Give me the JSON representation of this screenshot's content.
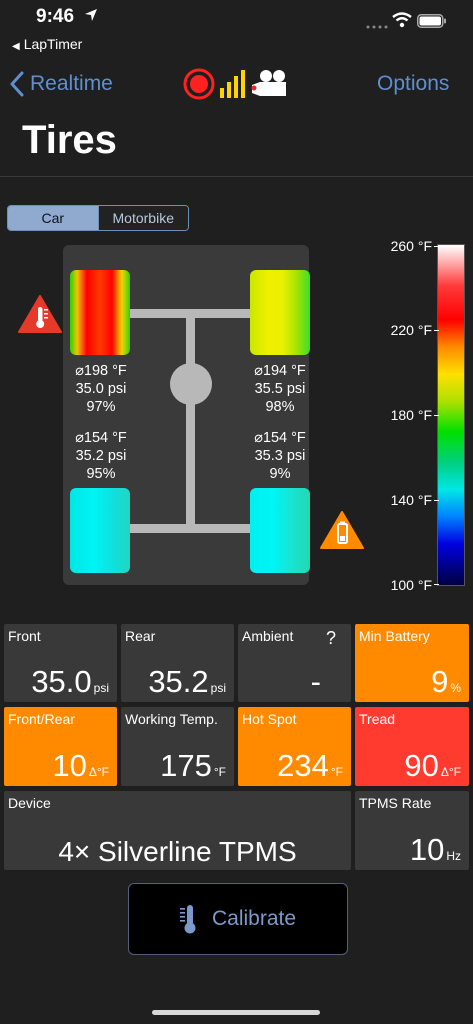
{
  "status": {
    "time": "9:46",
    "back_app": "LapTimer"
  },
  "nav": {
    "back_label": "Realtime",
    "options_label": "Options"
  },
  "title": "Tires",
  "segmented": {
    "options": [
      "Car",
      "Motorbike"
    ],
    "selected": "Car"
  },
  "tires": {
    "front_left": {
      "temp": "⌀198 °F",
      "pressure": "35.0 psi",
      "battery": "97%"
    },
    "front_right": {
      "temp": "⌀194 °F",
      "pressure": "35.5 psi",
      "battery": "98%"
    },
    "rear_left": {
      "temp": "⌀154 °F",
      "pressure": "35.2 psi",
      "battery": "95%"
    },
    "rear_right": {
      "temp": "⌀154 °F",
      "pressure": "35.3 psi",
      "battery": "9%"
    }
  },
  "scale": {
    "labels": [
      "260 °F",
      "220 °F",
      "180 °F",
      "140 °F",
      "100 °F"
    ]
  },
  "tiles": {
    "front": {
      "label": "Front",
      "value": "35.0",
      "unit": "psi"
    },
    "rear": {
      "label": "Rear",
      "value": "35.2",
      "unit": "psi"
    },
    "ambient": {
      "label": "Ambient",
      "value": "-",
      "help": "?"
    },
    "min_battery": {
      "label": "Min Battery",
      "value": "9",
      "unit": "%"
    },
    "front_rear": {
      "label": "Front/Rear",
      "value": "10",
      "unit": "Δ°F"
    },
    "working_temp": {
      "label": "Working Temp.",
      "value": "175",
      "unit": "°F"
    },
    "hot_spot": {
      "label": "Hot Spot",
      "value": "234",
      "unit": "°F"
    },
    "tread": {
      "label": "Tread",
      "value": "90",
      "unit": "Δ°F"
    },
    "device": {
      "label": "Device",
      "value": "4× Silverline TPMS"
    },
    "tpms_rate": {
      "label": "TPMS Rate",
      "value": "10",
      "unit": "Hz"
    }
  },
  "calibrate": {
    "label": "Calibrate"
  },
  "colors": {
    "accent": "#5f8fd0",
    "orange": "#ff8a00",
    "red": "#ff3b30",
    "tile": "#393939"
  }
}
